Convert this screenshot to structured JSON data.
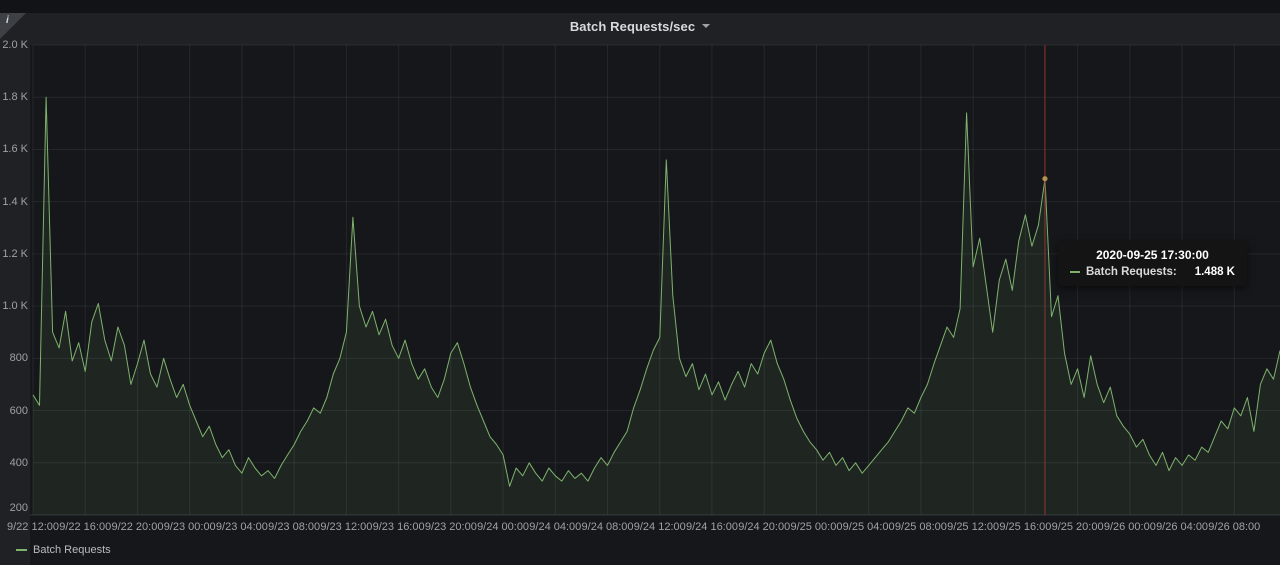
{
  "panel": {
    "title": "Batch Requests/sec",
    "info_icon_glyph": "i"
  },
  "tooltip": {
    "timestamp": "2020-09-25 17:30:00",
    "series_label": "Batch Requests:",
    "value": "1.488 K"
  },
  "legend": {
    "items": [
      {
        "label": "Batch Requests",
        "color": "#7eb26d"
      }
    ]
  },
  "colors": {
    "page_bg": "#1f2124",
    "plot_bg": "#15171a",
    "grid": "rgba(255,255,255,0.07)",
    "axis_line": "#33373b",
    "tick_text": "#9da2a8",
    "series_green": "#7eb26d",
    "crosshair_red": "#8f3434",
    "hover_marker": "#b5924e",
    "tooltip_bg": "#141414"
  },
  "chart_data": {
    "type": "line",
    "title": "Batch Requests/sec",
    "x_start": "2020-09-22 12:00",
    "x_end": "2020-09-26 11:30",
    "interval_minutes": 30,
    "x_range_hours": 95.5,
    "y_min": 200,
    "y_max": 2000,
    "grid": true,
    "legend_position": "bottom-left",
    "y_ticks": [
      {
        "value": 2000,
        "label": "2.0 K"
      },
      {
        "value": 1800,
        "label": "1.8 K"
      },
      {
        "value": 1600,
        "label": "1.6 K"
      },
      {
        "value": 1400,
        "label": "1.4 K"
      },
      {
        "value": 1200,
        "label": "1.2 K"
      },
      {
        "value": 1000,
        "label": "1.0 K"
      },
      {
        "value": 800,
        "label": "800"
      },
      {
        "value": 600,
        "label": "600"
      },
      {
        "value": 400,
        "label": "400"
      },
      {
        "value": 200,
        "label": "200"
      }
    ],
    "x_ticks": [
      {
        "hour": 0,
        "label": "9/22 12:00"
      },
      {
        "hour": 4,
        "label": "9/22 16:00"
      },
      {
        "hour": 8,
        "label": "9/22 20:00"
      },
      {
        "hour": 12,
        "label": "9/23 00:00"
      },
      {
        "hour": 16,
        "label": "9/23 04:00"
      },
      {
        "hour": 20,
        "label": "9/23 08:00"
      },
      {
        "hour": 24,
        "label": "9/23 12:00"
      },
      {
        "hour": 28,
        "label": "9/23 16:00"
      },
      {
        "hour": 32,
        "label": "9/23 20:00"
      },
      {
        "hour": 36,
        "label": "9/24 00:00"
      },
      {
        "hour": 40,
        "label": "9/24 04:00"
      },
      {
        "hour": 44,
        "label": "9/24 08:00"
      },
      {
        "hour": 48,
        "label": "9/24 12:00"
      },
      {
        "hour": 52,
        "label": "9/24 16:00"
      },
      {
        "hour": 56,
        "label": "9/24 20:00"
      },
      {
        "hour": 60,
        "label": "9/25 00:00"
      },
      {
        "hour": 64,
        "label": "9/25 04:00"
      },
      {
        "hour": 68,
        "label": "9/25 08:00"
      },
      {
        "hour": 72,
        "label": "9/25 12:00"
      },
      {
        "hour": 76,
        "label": "9/25 16:00"
      },
      {
        "hour": 80,
        "label": "9/25 20:00"
      },
      {
        "hour": 84,
        "label": "9/26 00:00"
      },
      {
        "hour": 88,
        "label": "9/26 04:00"
      },
      {
        "hour": 92,
        "label": "9/26 08:00"
      }
    ],
    "series": [
      {
        "name": "Batch Requests",
        "color": "#7eb26d",
        "fill_opacity": 0.1,
        "values": [
          660,
          620,
          1800,
          900,
          840,
          980,
          790,
          860,
          750,
          940,
          1010,
          870,
          790,
          920,
          850,
          700,
          780,
          870,
          740,
          690,
          800,
          720,
          650,
          700,
          620,
          560,
          500,
          540,
          470,
          420,
          450,
          390,
          360,
          420,
          380,
          350,
          370,
          340,
          390,
          430,
          470,
          520,
          560,
          610,
          590,
          650,
          740,
          800,
          900,
          1340,
          1000,
          920,
          980,
          890,
          950,
          850,
          800,
          870,
          780,
          720,
          760,
          690,
          650,
          720,
          820,
          860,
          780,
          690,
          620,
          560,
          500,
          470,
          430,
          310,
          380,
          350,
          400,
          360,
          330,
          380,
          350,
          330,
          370,
          340,
          360,
          330,
          380,
          420,
          390,
          440,
          480,
          520,
          610,
          680,
          760,
          830,
          880,
          1560,
          1040,
          800,
          730,
          780,
          680,
          740,
          660,
          710,
          640,
          700,
          750,
          690,
          780,
          740,
          820,
          870,
          780,
          720,
          640,
          570,
          520,
          480,
          450,
          410,
          440,
          390,
          420,
          370,
          400,
          360,
          390,
          420,
          450,
          480,
          520,
          560,
          610,
          590,
          650,
          700,
          780,
          850,
          920,
          880,
          990,
          1740,
          1150,
          1260,
          1080,
          900,
          1100,
          1180,
          1060,
          1250,
          1350,
          1230,
          1310,
          1488,
          960,
          1040,
          820,
          700,
          760,
          650,
          810,
          700,
          630,
          690,
          580,
          540,
          510,
          460,
          490,
          430,
          390,
          440,
          370,
          420,
          390,
          430,
          410,
          460,
          440,
          500,
          560,
          530,
          610,
          580,
          650,
          520,
          700,
          760,
          720,
          830
        ]
      }
    ],
    "annotations": {
      "crosshair_hour": 77.5,
      "hover_point": {
        "hour": 77.5,
        "value": 1488
      }
    }
  }
}
